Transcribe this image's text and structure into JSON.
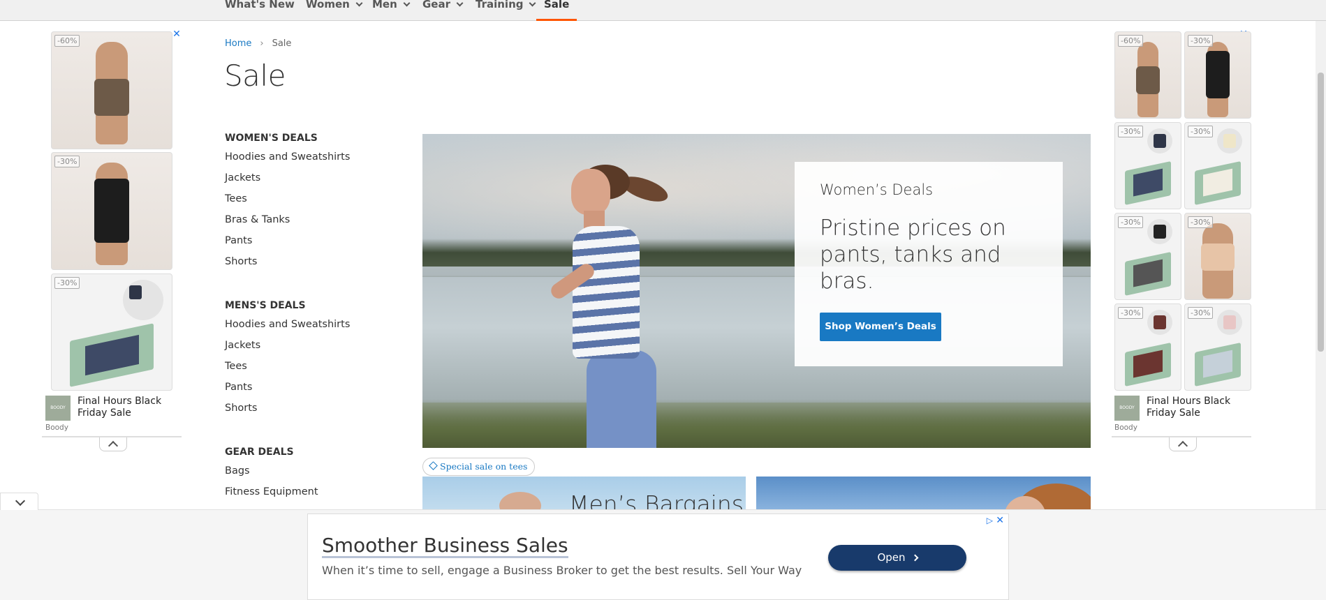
{
  "nav": {
    "items": [
      {
        "label": "What's New",
        "dropdown": false
      },
      {
        "label": "Women",
        "dropdown": true
      },
      {
        "label": "Men",
        "dropdown": true
      },
      {
        "label": "Gear",
        "dropdown": true
      },
      {
        "label": "Training",
        "dropdown": true
      },
      {
        "label": "Sale",
        "dropdown": false,
        "active": true
      }
    ]
  },
  "breadcrumb": {
    "home": "Home",
    "current": "Sale"
  },
  "page_title": "Sale",
  "sidebar": {
    "groups": [
      {
        "heading": "WOMEN'S DEALS",
        "items": [
          "Hoodies and Sweatshirts",
          "Jackets",
          "Tees",
          "Bras & Tanks",
          "Pants",
          "Shorts"
        ]
      },
      {
        "heading": "MENS'S DEALS",
        "items": [
          "Hoodies and Sweatshirts",
          "Jackets",
          "Tees",
          "Pants",
          "Shorts"
        ]
      },
      {
        "heading": "GEAR DEALS",
        "items": [
          "Bags",
          "Fitness Equipment"
        ]
      }
    ]
  },
  "hero": {
    "eyebrow": "Women’s Deals",
    "headline": "Pristine prices on pants, tanks and bras.",
    "button": "Shop Women’s Deals"
  },
  "tag": {
    "label": "Special sale on tees"
  },
  "promos": {
    "men_title": "Men’s Bargains"
  },
  "side_ads": {
    "left": {
      "discounts": [
        "-60%",
        "-30%",
        "-30%"
      ],
      "headline": "Final Hours Black Friday Sale",
      "advertiser": "Boody",
      "logo_text": "BOODY"
    },
    "right": {
      "discounts": [
        "-60%",
        "-30%",
        "-30%",
        "-30%",
        "-30%",
        "-30%",
        "-30%",
        "-30%"
      ],
      "headline": "Final Hours Black Friday Sale",
      "advertiser": "Boody",
      "logo_text": "BOODY"
    }
  },
  "bottom_ad": {
    "headline": "Smoother Business Sales",
    "text": "When it’s time to sell, engage a Business Broker to get the best results. Sell Your Way",
    "button": "Open"
  },
  "colors": {
    "accent": "#1979c3",
    "active_underline": "#ff5501",
    "ad_button": "#183a6b"
  },
  "icons": [
    "chevron-down-icon",
    "chevron-up-icon",
    "adchoices-icon",
    "close-icon",
    "tag-icon",
    "chevron-right-icon"
  ]
}
